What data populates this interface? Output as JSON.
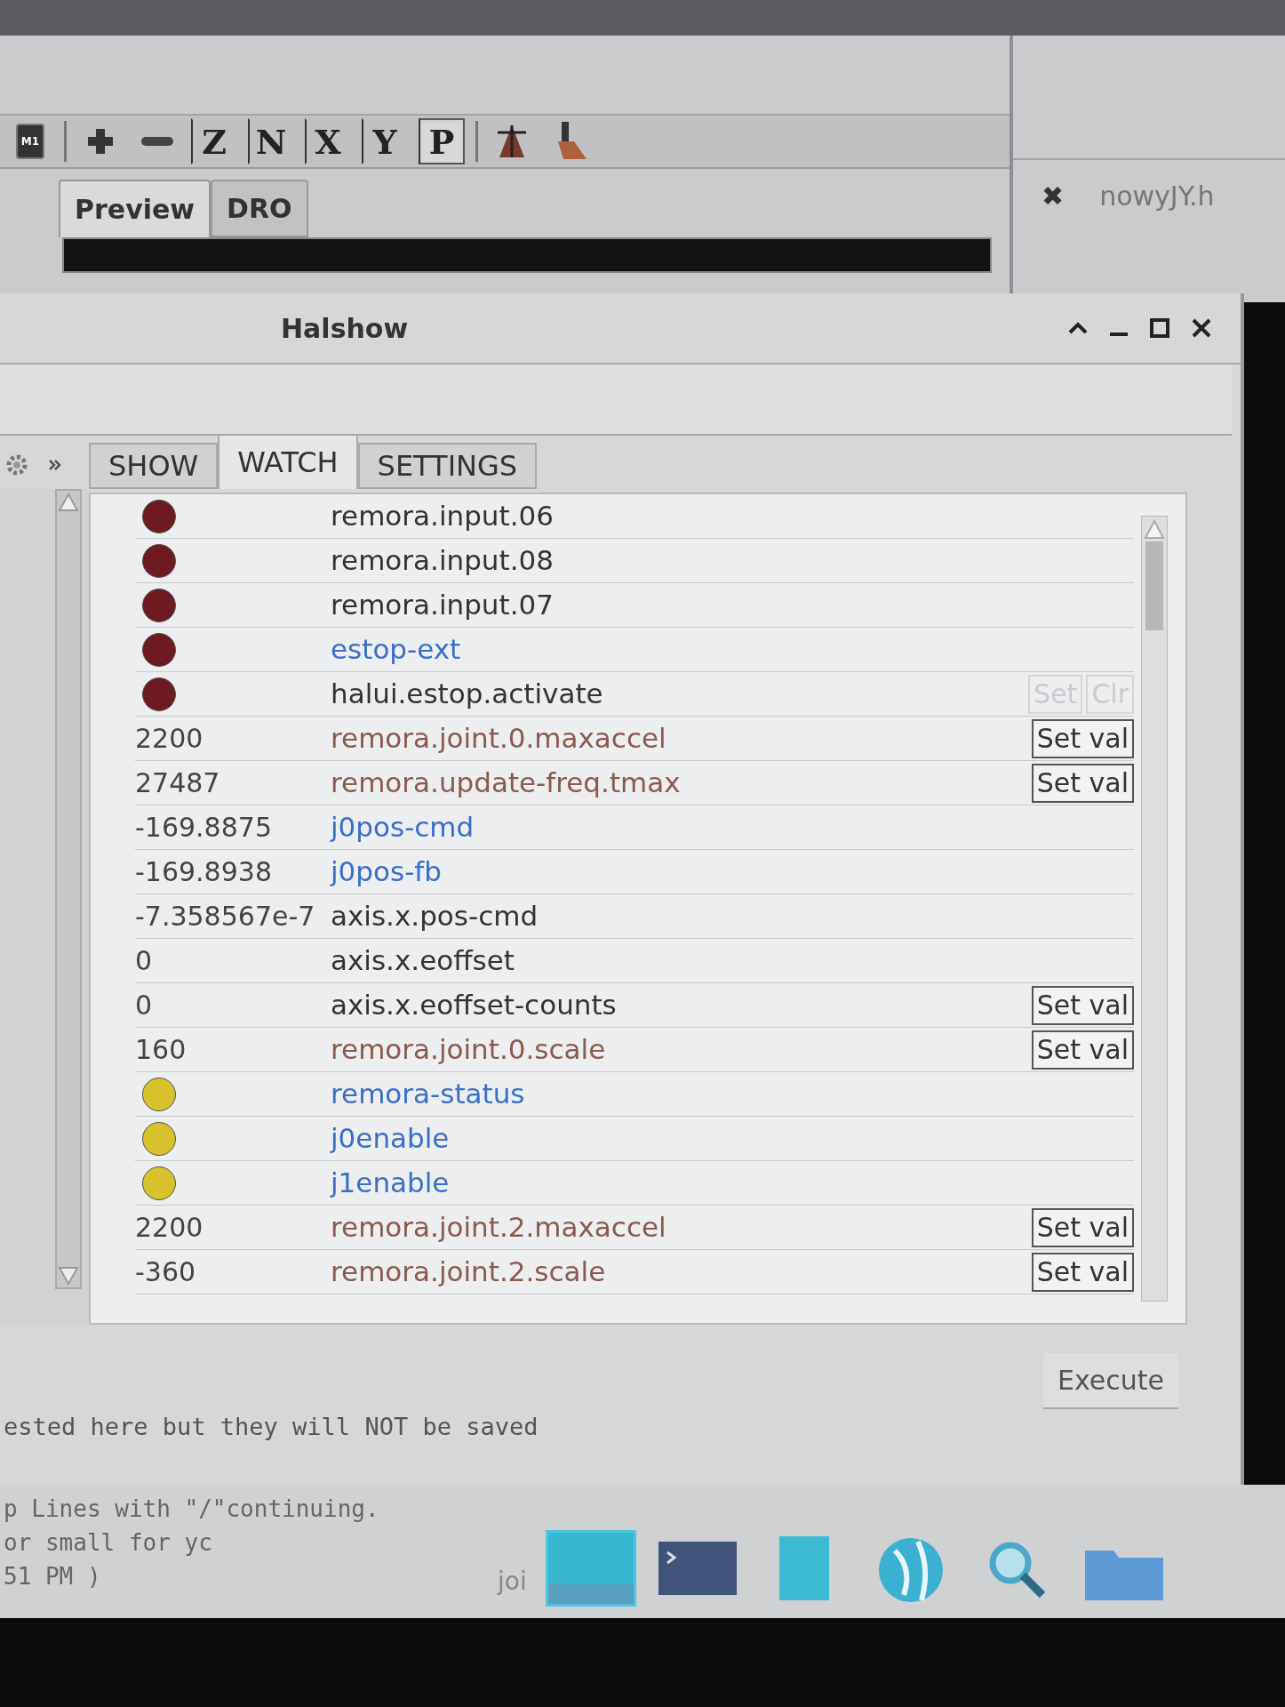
{
  "toolbar": [
    {
      "kind": "machine",
      "label": "M1",
      "selected": false
    },
    {
      "kind": "plus",
      "selected": false
    },
    {
      "kind": "minus",
      "selected": false
    },
    {
      "kind": "letter",
      "label": "Z",
      "selected": false
    },
    {
      "kind": "letter",
      "label": "N",
      "selected": false
    },
    {
      "kind": "letter",
      "label": "X",
      "selected": false
    },
    {
      "kind": "letter",
      "label": "Y",
      "selected": false
    },
    {
      "kind": "letter",
      "label": "P",
      "selected": true
    },
    {
      "kind": "tool",
      "selected": false
    },
    {
      "kind": "brush",
      "selected": false
    }
  ],
  "back_tabs": [
    {
      "label": "Preview",
      "selected": true
    },
    {
      "label": "DRO",
      "selected": false
    }
  ],
  "side_panel": {
    "close": "✖",
    "file": "nowyJY.h"
  },
  "window": {
    "title": "Halshow"
  },
  "tabs": [
    {
      "label": "SHOW",
      "selected": false
    },
    {
      "label": "WATCH",
      "selected": true
    },
    {
      "label": "SETTINGS",
      "selected": false
    }
  ],
  "watch": [
    {
      "kind": "bit",
      "on": false,
      "name": "remora.input.06",
      "color": "#333333"
    },
    {
      "kind": "bit",
      "on": false,
      "name": "remora.input.08",
      "color": "#333333"
    },
    {
      "kind": "bit",
      "on": false,
      "name": "remora.input.07",
      "color": "#333333"
    },
    {
      "kind": "bit",
      "on": false,
      "name": "estop-ext",
      "color": "#3a6fc6"
    },
    {
      "kind": "bit",
      "on": false,
      "name": "halui.estop.activate",
      "color": "#333333",
      "buttons": [
        {
          "label": "Set",
          "disabled": true
        },
        {
          "label": "Clr",
          "disabled": true
        }
      ]
    },
    {
      "kind": "value",
      "value": "2200",
      "name": "remora.joint.0.maxaccel",
      "color": "#8a5a4e",
      "buttons": [
        {
          "label": "Set val",
          "disabled": false
        }
      ]
    },
    {
      "kind": "value",
      "value": "27487",
      "name": "remora.update-freq.tmax",
      "color": "#8a5a4e",
      "buttons": [
        {
          "label": "Set val",
          "disabled": false
        }
      ]
    },
    {
      "kind": "value",
      "value": "-169.8875",
      "name": "j0pos-cmd",
      "color": "#3a6fc6"
    },
    {
      "kind": "value",
      "value": "-169.8938",
      "name": "j0pos-fb",
      "color": "#3a6fc6"
    },
    {
      "kind": "value",
      "value": "-7.358567e-7",
      "name": "axis.x.pos-cmd",
      "color": "#333333"
    },
    {
      "kind": "value",
      "value": "0",
      "name": "axis.x.eoffset",
      "color": "#333333"
    },
    {
      "kind": "value",
      "value": "0",
      "name": "axis.x.eoffset-counts",
      "color": "#333333",
      "buttons": [
        {
          "label": "Set val",
          "disabled": false
        }
      ]
    },
    {
      "kind": "value",
      "value": "160",
      "name": "remora.joint.0.scale",
      "color": "#8a5a4e",
      "buttons": [
        {
          "label": "Set val",
          "disabled": false
        }
      ]
    },
    {
      "kind": "bit",
      "on": true,
      "name": "remora-status",
      "color": "#3a6fc6"
    },
    {
      "kind": "bit",
      "on": true,
      "name": "j0enable",
      "color": "#3a6fc6"
    },
    {
      "kind": "bit",
      "on": true,
      "name": "j1enable",
      "color": "#3a6fc6"
    },
    {
      "kind": "value",
      "value": "2200",
      "name": "remora.joint.2.maxaccel",
      "color": "#8a5a4e",
      "buttons": [
        {
          "label": "Set val",
          "disabled": false
        }
      ]
    },
    {
      "kind": "value",
      "value": "-360",
      "name": "remora.joint.2.scale",
      "color": "#8a5a4e",
      "buttons": [
        {
          "label": "Set val",
          "disabled": false
        }
      ]
    }
  ],
  "execute_button": "Execute",
  "command_note": "ested here but they will NOT be saved",
  "console": [
    "p Lines with \"/\"continuing.",
    "or small for yc",
    "51 PM )"
  ],
  "taskbar": {
    "label": "joi",
    "apps": [
      {
        "kind": "window",
        "selected": true
      },
      {
        "kind": "terminal",
        "selected": false
      },
      {
        "kind": "notes",
        "selected": false
      },
      {
        "kind": "globe",
        "selected": false
      },
      {
        "kind": "search",
        "selected": false
      },
      {
        "kind": "folder",
        "selected": false
      }
    ]
  }
}
